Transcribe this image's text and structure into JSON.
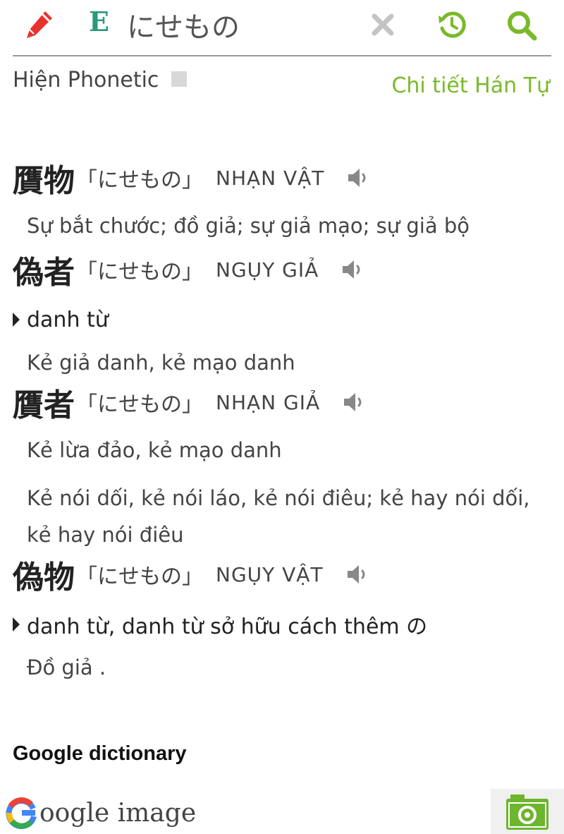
{
  "header": {
    "lang_label": "E",
    "search_value": "にせもの"
  },
  "phonetic": {
    "label": "Hiện Phonetic",
    "kanji_link": "Chi tiết Hán Tự"
  },
  "entries": [
    {
      "kanji": "贋物",
      "reading": "「にせもの」",
      "hanviet": "NHẠN VẬT",
      "pos": "",
      "meanings": [
        "Sự bắt chước; đồ giả; sự giả mạo; sự giả bộ"
      ]
    },
    {
      "kanji": "偽者",
      "reading": "「にせもの」",
      "hanviet": "NGỤY GIẢ",
      "pos": "danh từ",
      "meanings": [
        "Kẻ giả danh, kẻ mạo danh"
      ]
    },
    {
      "kanji": "贋者",
      "reading": "「にせもの」",
      "hanviet": "NHẠN GIẢ",
      "pos": "",
      "meanings": [
        "Kẻ lừa đảo, kẻ mạo danh",
        "Kẻ nói dối, kẻ nói láo, kẻ nói điêu; kẻ hay nói dối, kẻ hay nói điêu"
      ]
    },
    {
      "kanji": "偽物",
      "reading": "「にせもの」",
      "hanviet": "NGỤY VẬT",
      "pos": "danh từ, danh từ sở hữu cách thêm の",
      "meanings": [
        "Đồ giả ."
      ]
    }
  ],
  "google_dictionary": "Google dictionary",
  "google_image": {
    "text": "oogle image"
  },
  "colors": {
    "accent_green": "#7ab92a",
    "pencil_red": "#e8322e",
    "lang_teal": "#2a9a7a"
  }
}
